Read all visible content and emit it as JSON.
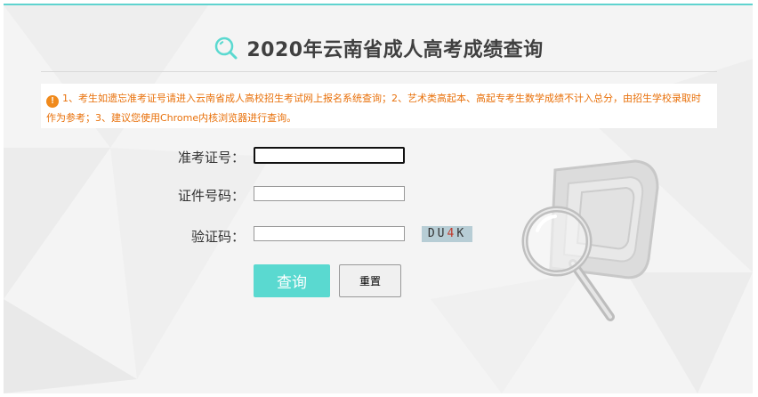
{
  "page": {
    "title": "2020年云南省成人高考成绩查询"
  },
  "notice": {
    "icon_char": "!",
    "text": "1、考生如遗忘准考证号请进入云南省成人高校招生考试网上报名系统查询；2、艺术类高起本、高起专考生数学成绩不计入总分，由招生学校录取时作为参考；3、建议您使用Chrome内核浏览器进行查询。"
  },
  "form": {
    "exam_id_label": "准考证号：",
    "exam_id_value": "",
    "id_number_label": "证件号码：",
    "id_number_value": "",
    "captcha_label": "验证码：",
    "captcha_value": "",
    "captcha_chars": [
      "D",
      "U",
      "4",
      "K"
    ]
  },
  "buttons": {
    "query_label": "查询",
    "reset_label": "重置"
  },
  "colors": {
    "accent": "#5ad9d0",
    "top_border": "#5fd3cf",
    "notice_text": "#e8700a",
    "notice_icon": "#f08a1c"
  },
  "icons": {
    "title_icon": "search-icon",
    "notice_icon": "warning-icon",
    "illustration": "magnifier-document-illustration"
  }
}
